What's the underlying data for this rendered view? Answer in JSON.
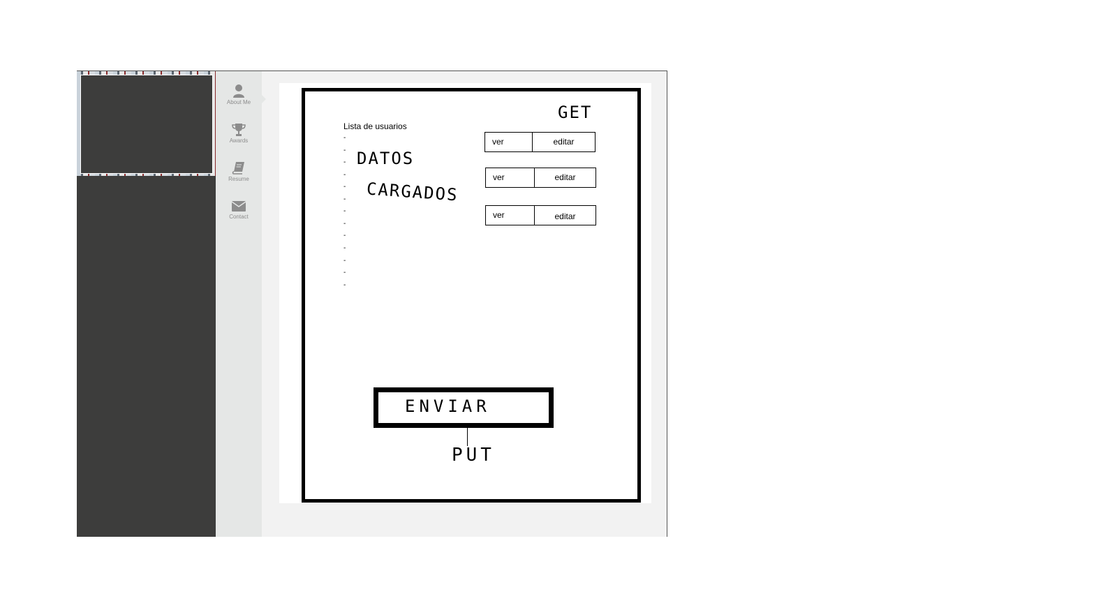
{
  "nav": {
    "items": [
      {
        "label": "About Me",
        "icon": "user-icon"
      },
      {
        "label": "Awards",
        "icon": "trophy-icon"
      },
      {
        "label": "Resume",
        "icon": "book-icon"
      },
      {
        "label": "Contact",
        "icon": "envelope-icon"
      }
    ]
  },
  "sketch": {
    "list_title": "Lista de usuarios",
    "dash": "-",
    "annotation_line1": "DATOS",
    "annotation_line2": "CARGADOS",
    "get_label": "GET",
    "rows": [
      {
        "view": "ver",
        "edit": "editar"
      },
      {
        "view": "ver",
        "edit": "editar"
      },
      {
        "view": "ver",
        "edit": "editar"
      }
    ],
    "submit_label": "ENVIAR",
    "put_label": "PUT"
  },
  "colors": {
    "sidebar_dark": "#3d3d3c",
    "nav_rail": "#e5e7e6",
    "nav_icon": "#8c8c8c",
    "page_bg": "#f2f2f2",
    "sketch_border": "#000000"
  }
}
